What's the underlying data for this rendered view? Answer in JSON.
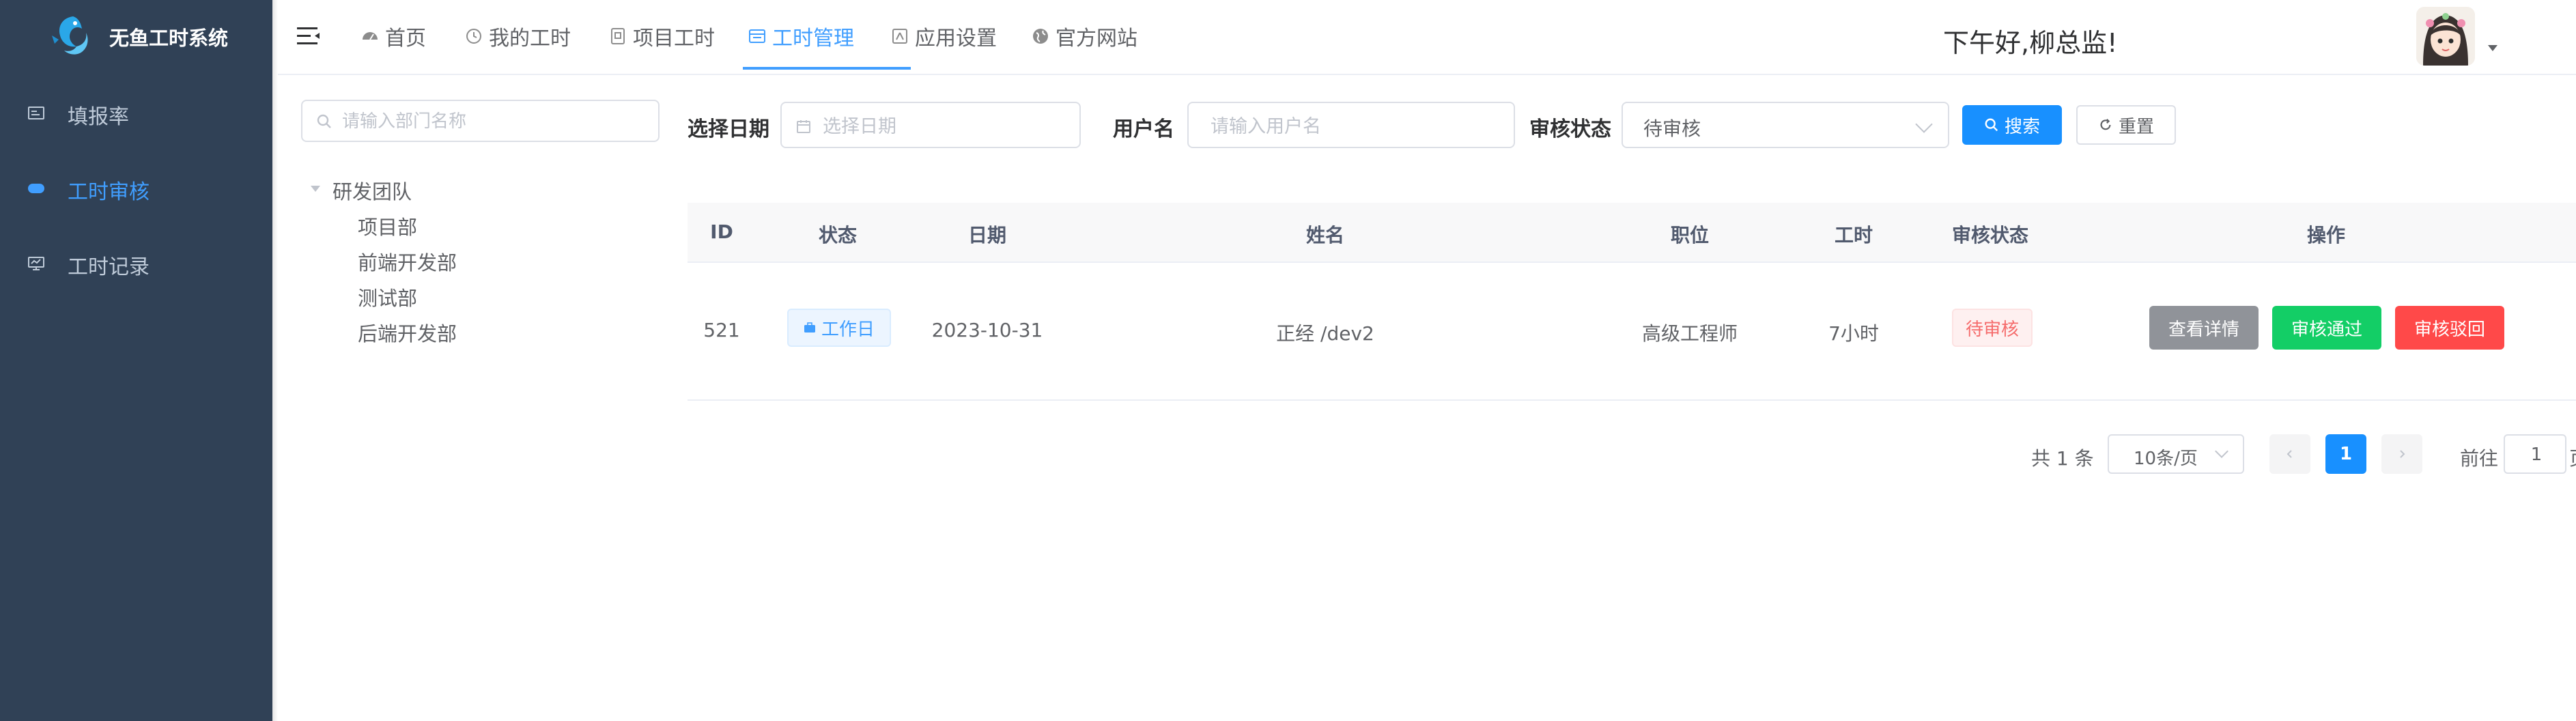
{
  "app": {
    "title": "无鱼工时系统"
  },
  "sidebar": {
    "items": [
      {
        "label": "填报率",
        "icon": "chart-icon"
      },
      {
        "label": "工时审核",
        "icon": "toggle-icon",
        "active": true
      },
      {
        "label": "工时记录",
        "icon": "monitor-icon"
      }
    ]
  },
  "topnav": {
    "items": [
      {
        "label": "首页",
        "icon": "dashboard-icon"
      },
      {
        "label": "我的工时",
        "icon": "clock-icon"
      },
      {
        "label": "项目工时",
        "icon": "project-icon"
      },
      {
        "label": "工时管理",
        "icon": "manage-icon",
        "active": true
      },
      {
        "label": "应用设置",
        "icon": "settings-icon"
      },
      {
        "label": "官方网站",
        "icon": "globe-icon"
      }
    ],
    "greeting": "下午好,柳总监!"
  },
  "tree": {
    "search_placeholder": "请输入部门名称",
    "root": "研发团队",
    "children": [
      "项目部",
      "前端开发部",
      "测试部",
      "后端开发部"
    ]
  },
  "filters": {
    "date_label": "选择日期",
    "date_placeholder": "选择日期",
    "user_label": "用户名",
    "user_placeholder": "请输入用户名",
    "status_label": "审核状态",
    "status_value": "待审核",
    "search_button": "搜索",
    "reset_button": "重置"
  },
  "table": {
    "columns": [
      "ID",
      "状态",
      "日期",
      "姓名",
      "职位",
      "工时",
      "审核状态",
      "操作"
    ],
    "rows": [
      {
        "id": "521",
        "status": "工作日",
        "date": "2023-10-31",
        "name": "正经 /dev2",
        "position": "高级工程师",
        "hours": "7小时",
        "review_status": "待审核",
        "actions": {
          "detail": "查看详情",
          "approve": "审核通过",
          "reject": "审核驳回"
        }
      }
    ]
  },
  "pagination": {
    "total": "共 1 条",
    "page_size": "10条/页",
    "current_page": "1",
    "goto_label": "前往",
    "goto_value": "1",
    "page_suffix": "页"
  },
  "colors": {
    "sidebar_bg": "#304156",
    "primary": "#1890ff",
    "approve": "#13ce66",
    "reject": "#ff4949",
    "detail": "#909399"
  }
}
